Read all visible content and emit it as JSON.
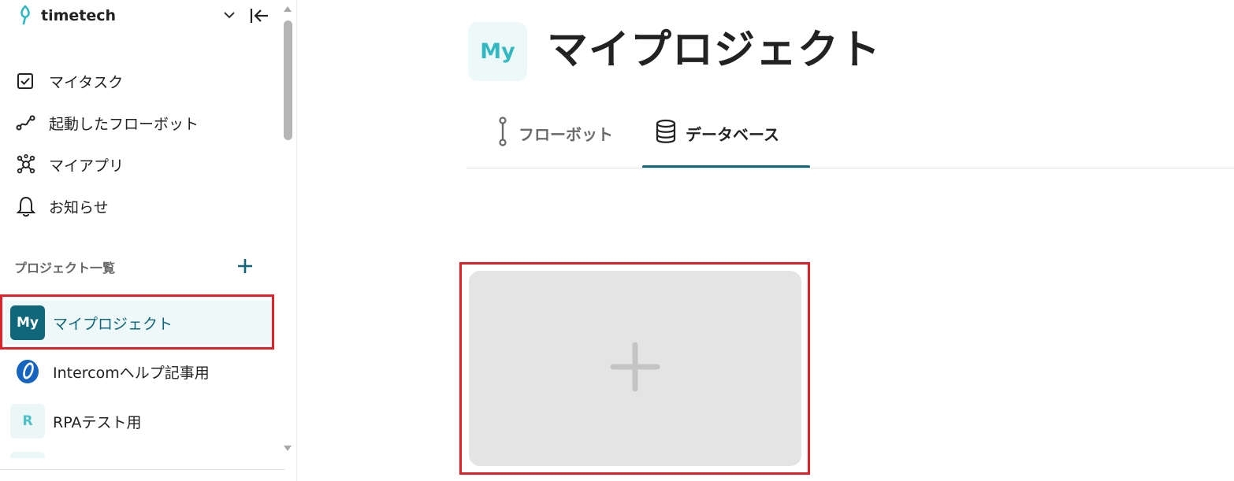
{
  "sidebar": {
    "brand": {
      "name": "timetech"
    },
    "nav": [
      {
        "label": "マイタスク",
        "icon": "checkbox-icon"
      },
      {
        "label": "起動したフローボット",
        "icon": "flow-icon"
      },
      {
        "label": "マイアプリ",
        "icon": "apps-network-icon"
      },
      {
        "label": "お知らせ",
        "icon": "bell-icon"
      }
    ],
    "projects_section": {
      "label": "プロジェクト一覧",
      "add_icon": "plus-icon"
    },
    "projects": [
      {
        "avatar": "My",
        "label": "マイプロジェクト",
        "active": true
      },
      {
        "avatar": "",
        "label": "Intercomヘルプ記事用",
        "icon": "intercom-logo-icon"
      },
      {
        "avatar": "R",
        "label": "RPAテスト用"
      }
    ]
  },
  "main": {
    "header": {
      "avatar": "My",
      "title": "マイプロジェクト"
    },
    "tabs": [
      {
        "label": "フローボット",
        "icon": "flowbot-icon",
        "selected": false
      },
      {
        "label": "データベース",
        "icon": "database-icon",
        "selected": true
      }
    ],
    "add_card": {
      "icon": "plus-icon"
    }
  },
  "colors": {
    "accent": "#10677a",
    "highlight": "#e0202b",
    "brand": "#2fb8c4"
  }
}
